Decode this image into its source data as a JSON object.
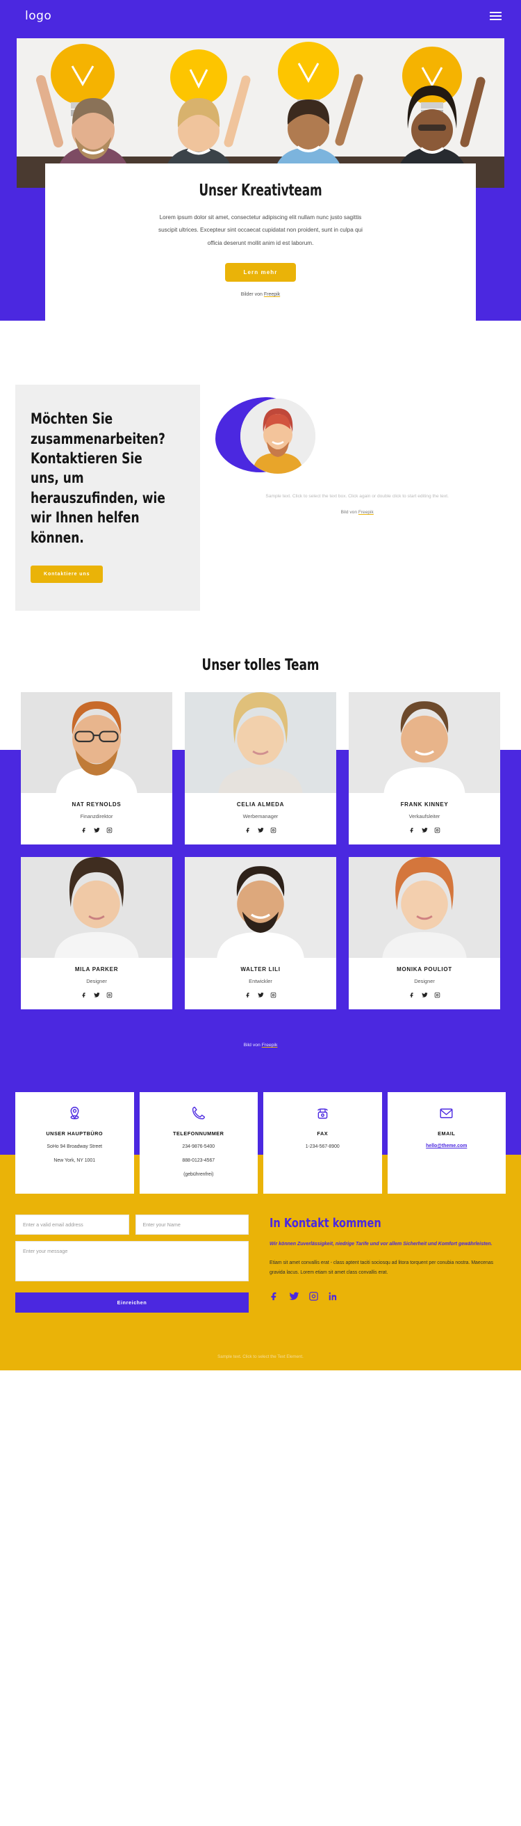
{
  "header": {
    "logo": "logo",
    "menu_icon": "hamburger-menu-icon"
  },
  "hero": {
    "title": "Unser Kreativteam",
    "paragraph": "Lorem ipsum dolor sit amet, consectetur adipiscing elit nullam nunc justo sagittis suscipit ultrices. Excepteur sint occaecat cupidatat non proident, sunt in culpa qui officia deserunt mollit anim id est laborum.",
    "cta_label": "Lern mehr",
    "credit_prefix": "Bilder von ",
    "credit_link": "Freepik"
  },
  "collab": {
    "heading": "Möchten Sie zusammenarbeiten? Kontaktieren Sie uns, um herauszufinden, wie wir Ihnen helfen können.",
    "cta_label": "Kontaktiere uns",
    "sample_text": "Sample text. Click to select the text box. Click again or double click to start editing the text.",
    "credit_prefix": "Bild von ",
    "credit_link": "Freepik"
  },
  "team": {
    "title": "Unser tolles Team",
    "credit_prefix": "Bild von ",
    "credit_link": "Freepik",
    "members": [
      {
        "name": "NAT REYNOLDS",
        "role": "Finanzdirektor"
      },
      {
        "name": "CELIA ALMEDA",
        "role": "Werbemanager"
      },
      {
        "name": "FRANK KINNEY",
        "role": "Verkaufsleiter"
      },
      {
        "name": "MILA PARKER",
        "role": "Designer"
      },
      {
        "name": "WALTER LILI",
        "role": "Entwickler"
      },
      {
        "name": "MONIKA POULIOT",
        "role": "Designer"
      }
    ],
    "social_icons": [
      "facebook-icon",
      "twitter-icon",
      "instagram-icon"
    ]
  },
  "contact_cards": [
    {
      "icon": "location-pin-icon",
      "title": "UNSER HAUPTBÜRO",
      "line1": "SoHo 94 Broadway Street",
      "line2": "New York, NY 1001",
      "line3": ""
    },
    {
      "icon": "phone-icon",
      "title": "TELEFONNUMMER",
      "line1": "234-9876-5400",
      "line2": "888-0123-4567",
      "line3": "(gebührenfrei)"
    },
    {
      "icon": "fax-icon",
      "title": "FAX",
      "line1": "1-234-567-8900",
      "line2": "",
      "line3": ""
    },
    {
      "icon": "envelope-icon",
      "title": "EMAIL",
      "email": "hello@theme.com"
    }
  ],
  "form": {
    "email_placeholder": "Enter a valid email address",
    "name_placeholder": "Enter your Name",
    "message_placeholder": "Enter your message",
    "submit_label": "Einreichen",
    "heading": "In Kontakt kommen",
    "lead": "Wir können Zuverlässigkeit, niedrige Tarife und vor allem Sicherheit und Komfort gewährleisten.",
    "body": "Etiam sit amet convallis erat - class aptent taciti sociosqu ad litora torquent per conubia nostra. Maecenas gravida lacus. Lorem etiam sit amet class convallis erat.",
    "social_icons": [
      "facebook-icon",
      "twitter-icon",
      "instagram-icon",
      "linkedin-icon"
    ]
  },
  "footer": {
    "note": "Sample text. Click to select the Text Element."
  },
  "colors": {
    "purple": "#4b28e0",
    "yellow": "#eab308",
    "grey_panel": "#efefef"
  }
}
